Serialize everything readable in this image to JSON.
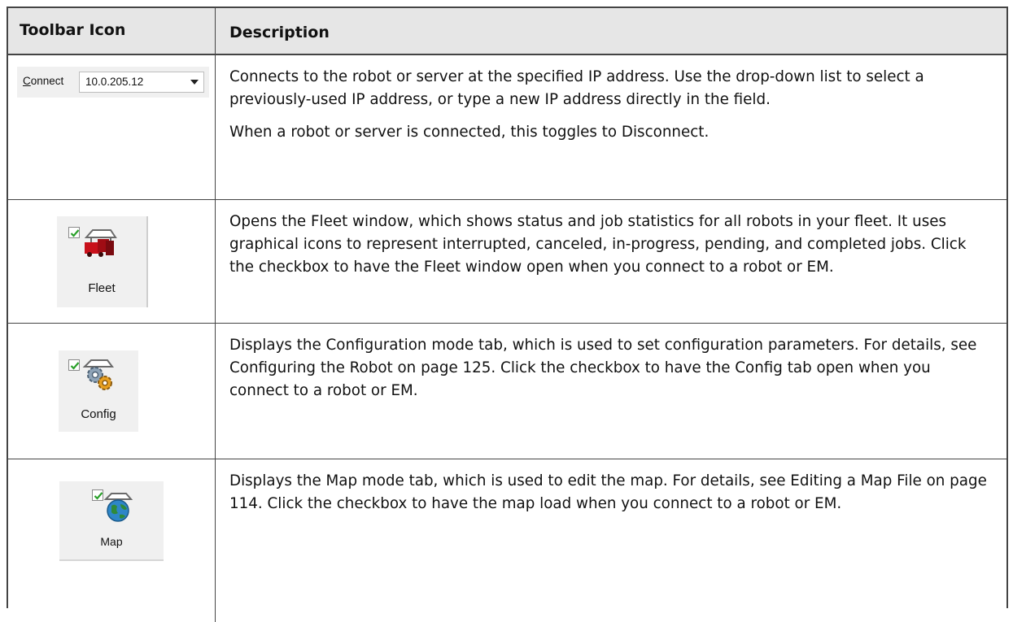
{
  "header": {
    "col1": "Toolbar Icon",
    "col2": "Description"
  },
  "rows": [
    {
      "widget": {
        "label_accel": "C",
        "label_rest": "onnect",
        "value": "10.0.205.12"
      },
      "paragraphs": [
        "Connects to the robot or server at the specified IP address. Use the drop-down list to select a previously-used IP address, or type a new IP address directly in the field.",
        "When a robot or server is connected, this toggles to Disconnect."
      ]
    },
    {
      "button_label": "Fleet",
      "icon": "fleet-robot-icon",
      "paragraphs": [
        "Opens the Fleet window, which shows status and job statistics for all robots in your fleet. It uses graphical icons to represent interrupted, canceled, in-progress, pending, and completed jobs. Click the checkbox to have the Fleet window open when you connect to a robot or EM."
      ]
    },
    {
      "button_label": "Config",
      "icon": "config-gears-icon",
      "paragraphs": [
        "Displays the Configuration mode tab, which is used to set configuration parameters. For details, see Configuring the Robot on page 125. Click the checkbox to have the Config tab open when you connect to a robot or EM."
      ]
    },
    {
      "button_label": "Map",
      "icon": "map-globe-icon",
      "paragraphs": [
        "Displays the Map mode tab, which is used to edit the map. For details, see Editing a Map File on page 114. Click the checkbox to have the map load when you connect to a robot or EM."
      ]
    }
  ],
  "colors": {
    "header_bg": "#e6e6e6",
    "rule": "#444444",
    "check_green": "#2aa02a"
  }
}
